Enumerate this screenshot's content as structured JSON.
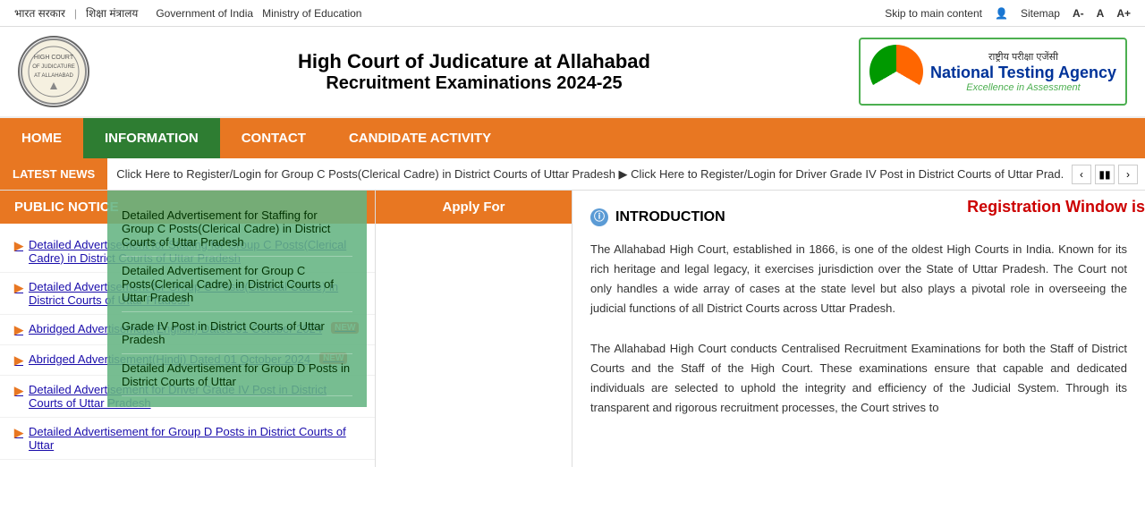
{
  "topbar": {
    "gov_hindi": "भारत सरकार",
    "separator1": "|",
    "ministry_hindi": "शिक्षा मंत्रालय",
    "gov_english": "Government of India",
    "ministry_english": "Ministry of Education",
    "skip_label": "Skip to main content",
    "sitemap_label": "Sitemap",
    "font_a_minus": "A-",
    "font_a": "A",
    "font_a_plus": "A+"
  },
  "header": {
    "title_line1": "High Court of Judicature at Allahabad",
    "title_line2": "Recruitment Examinations 2024-25",
    "nta_hindi": "राष्ट्रीय परीक्षा एजेंसी",
    "nta_english": "National Testing Agency",
    "nta_tagline": "Excellence in Assessment"
  },
  "nav": {
    "items": [
      {
        "id": "home",
        "label": "HOME"
      },
      {
        "id": "information",
        "label": "INFORMATION",
        "active": true
      },
      {
        "id": "contact",
        "label": "CONTACT"
      },
      {
        "id": "candidate_activity",
        "label": "CANDIDATE ACTIVITY"
      }
    ]
  },
  "ticker": {
    "label": "LATEST NEWS",
    "text": "Click Here to Register/Login for Group C Posts(Clerical Cadre) in District Courts of Uttar Pradesh   ▶   Click Here to Register/Login for Driver Grade IV Post in District Courts of Uttar Prad..."
  },
  "sidebar": {
    "header": "PUBLIC NOTICE",
    "links": [
      {
        "id": "detailed-adv-group-c",
        "text": "Detailed Advertisement for Staffing for Group C Posts(Clerical Cadre) in District Courts of Uttar Pradesh",
        "has_new": false
      },
      {
        "id": "detailed-adv-group-c-2",
        "text": "Detailed Advertisement for Group C Posts(Clerical Cadre) in District Courts of Uttar Pradesh",
        "has_new": false
      },
      {
        "id": "abridged-adv-english",
        "text": "Abridged Advertisement(English) Dated 01 October 2024",
        "has_new": true
      },
      {
        "id": "abridged-adv-hindi",
        "text": "Abridged Advertisement(Hindi) Dated 01 October 2024",
        "has_new": true
      },
      {
        "id": "detailed-adv-driver",
        "text": "Detailed Advertisement for Driver Grade IV Post in District Courts of Uttar Pradesh",
        "has_new": false
      },
      {
        "id": "detailed-adv-group-d",
        "text": "Detailed Advertisement for Group D Posts in District Courts of Uttar",
        "has_new": false
      }
    ]
  },
  "dropdown": {
    "items": [
      "Detailed Advertisement for Staffing for Group C Posts(Clerical Cadre) in District Courts of Uttar Pradesh",
      "Detailed Advertisement for Group C Posts(Clerical Cadre) in District Courts of Uttar Pradesh",
      "Grade IV Post in District Courts of Uttar Pradesh",
      "Detailed Advertisement for Group D Posts in District Courts of Uttar"
    ]
  },
  "center": {
    "header": "Apply For"
  },
  "registration_banner": "Registration Window is",
  "introduction": {
    "title": "INTRODUCTION",
    "paragraph1": "The Allahabad High Court, established in 1866, is one of the oldest High Courts in India. Known for its rich heritage and legal legacy, it exercises jurisdiction over the State of Uttar Pradesh. The Court not only handles a wide array of cases at the state level but also plays a pivotal role in overseeing the judicial functions of all District Courts across Uttar Pradesh.",
    "paragraph2": "The Allahabad High Court conducts Centralised Recruitment Examinations for both the Staff of District Courts and the Staff of the High Court. These examinations ensure that capable and dedicated individuals are selected to uphold the integrity and efficiency of the Judicial System. Through its transparent and rigorous recruitment processes, the Court strives to"
  }
}
